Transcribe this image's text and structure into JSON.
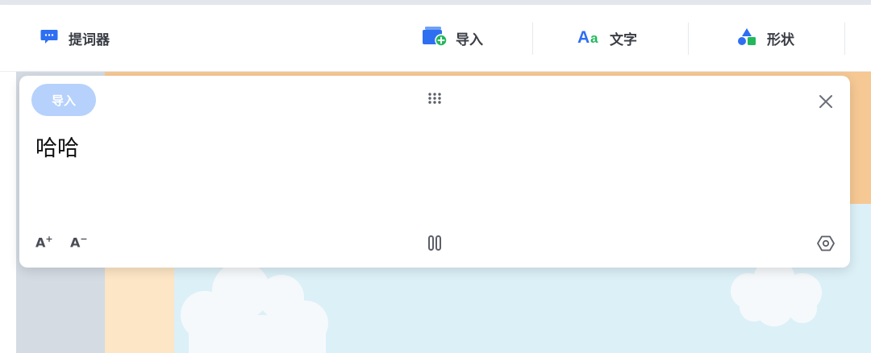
{
  "toolbar": {
    "teleprompter_label": "提词器",
    "teleprompter_icon": "chat-bubble-icon",
    "import_label": "导入",
    "import_icon": "folder-add-icon",
    "text_label": "文字",
    "text_icon": "text-aa-icon",
    "shape_label": "形状",
    "shape_icon": "shapes-icon"
  },
  "panel": {
    "import_button_label": "导入",
    "script_text": "哈哈",
    "font_increase_label": "A",
    "font_increase_mark": "+",
    "font_decrease_label": "A",
    "font_decrease_mark": "−",
    "icons": [
      "drag-handle-icon",
      "close-icon",
      "pause-icon",
      "settings-icon"
    ]
  },
  "colors": {
    "accent_blue": "#2e6ff2",
    "accent_green": "#22b85b",
    "import_button_bg": "#b6d1fb",
    "canvas_orange": "#f6c894",
    "canvas_sky": "#dcf0f8"
  }
}
